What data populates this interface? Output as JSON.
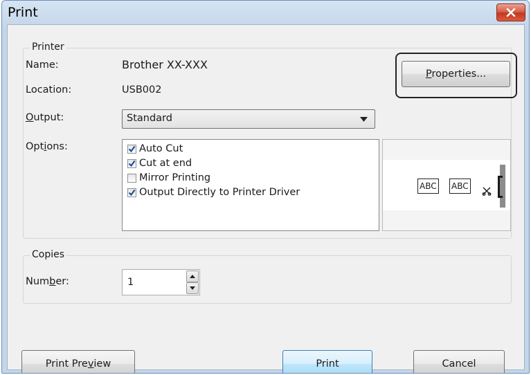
{
  "window": {
    "title": "Print"
  },
  "printer": {
    "group_label": "Printer",
    "name_label": "Name:",
    "name_value": "Brother XX-XXX",
    "location_label": "Location:",
    "location_value": "USB002",
    "output_label_pre": "",
    "output_label_key": "O",
    "output_label_post": "utput:",
    "output_value": "Standard",
    "properties_pre": "",
    "properties_key": "P",
    "properties_post": "roperties...",
    "options_label_pre": "Opt",
    "options_label_key": "i",
    "options_label_post": "ons:",
    "options": [
      {
        "label": "Auto Cut",
        "checked": true
      },
      {
        "label": "Cut at end",
        "checked": true
      },
      {
        "label": "Mirror Printing",
        "checked": false
      },
      {
        "label": "Output Directly to Printer Driver",
        "checked": true
      }
    ],
    "preview_labels": [
      "ABC",
      "ABC"
    ]
  },
  "copies": {
    "group_label": "Copies",
    "number_label_pre": "Num",
    "number_label_key": "b",
    "number_label_post": "er:",
    "number_value": "1"
  },
  "buttons": {
    "preview_pre": "Print Pre",
    "preview_key": "v",
    "preview_post": "iew",
    "print": "Print",
    "cancel": "Cancel"
  },
  "colors": {
    "close_button": "#c2391f",
    "default_button_border": "#3c7fb1",
    "check": "#1e4f9c"
  }
}
